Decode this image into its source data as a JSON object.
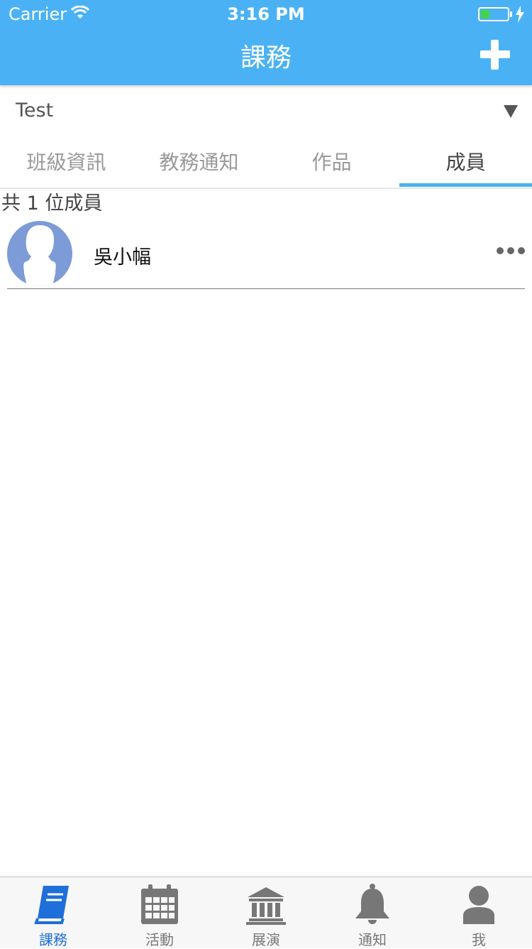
{
  "status_bar": {
    "carrier": "Carrier",
    "time": "3:16 PM"
  },
  "header": {
    "title": "課務",
    "add_icon": "plus-icon"
  },
  "class_selector": {
    "value": "Test"
  },
  "tabs": [
    {
      "label": "班級資訊"
    },
    {
      "label": "教務通知"
    },
    {
      "label": "作品"
    },
    {
      "label": "成員",
      "active": true
    }
  ],
  "members": {
    "count_text": "共 1 位成員",
    "items": [
      {
        "name": "吳小幅"
      }
    ]
  },
  "tabbar": [
    {
      "label": "課務",
      "icon": "book-icon",
      "active": true
    },
    {
      "label": "活動",
      "icon": "calendar-icon"
    },
    {
      "label": "展演",
      "icon": "museum-icon"
    },
    {
      "label": "通知",
      "icon": "bell-icon"
    },
    {
      "label": "我",
      "icon": "user-icon"
    }
  ],
  "colors": {
    "accent": "#4ab2f4",
    "active_tab": "#1e6fd9",
    "avatar": "#7d9bd6"
  }
}
